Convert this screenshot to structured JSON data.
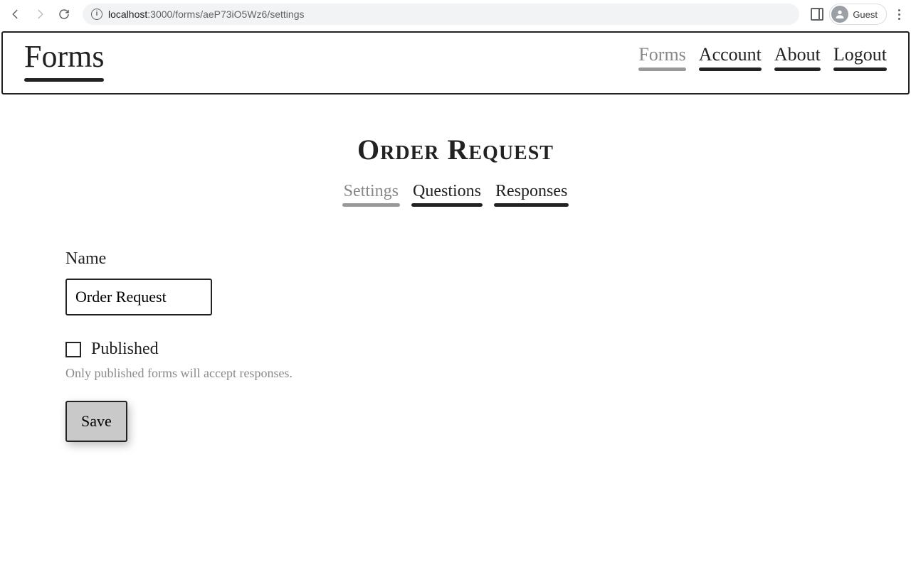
{
  "browser": {
    "url_host": "localhost",
    "url_rest": ":3000/forms/aeP73iO5Wz6/settings",
    "guest_label": "Guest"
  },
  "header": {
    "brand": "Forms",
    "nav": {
      "forms": "Forms",
      "account": "Account",
      "about": "About",
      "logout": "Logout"
    }
  },
  "page": {
    "title": "Order Request",
    "tabs": {
      "settings": "Settings",
      "questions": "Questions",
      "responses": "Responses"
    }
  },
  "form": {
    "name_label": "Name",
    "name_value": "Order Request",
    "published_label": "Published",
    "published_helper": "Only published forms will accept responses.",
    "save_label": "Save"
  }
}
